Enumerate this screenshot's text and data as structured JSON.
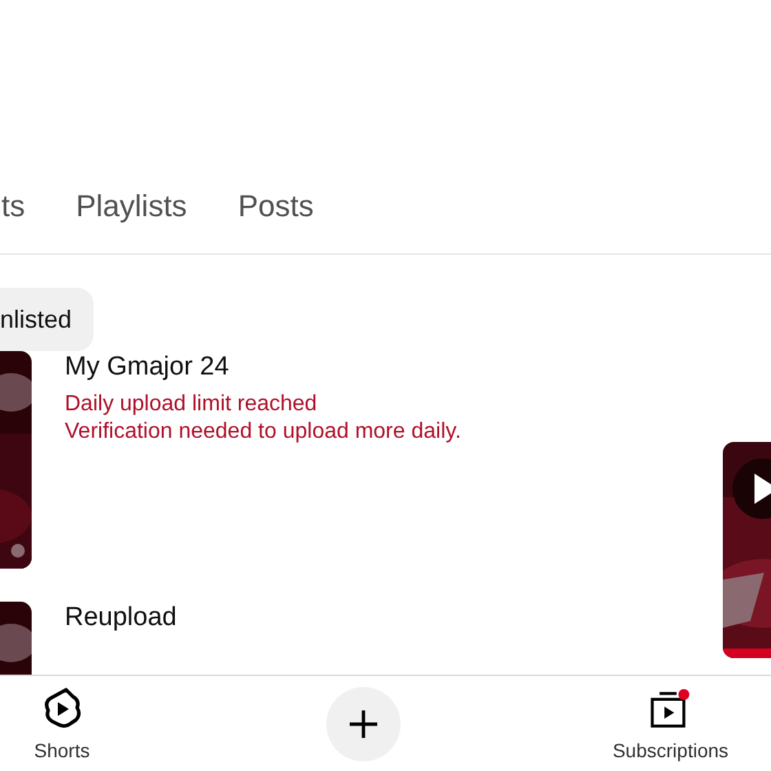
{
  "tabs": [
    {
      "label": "ts"
    },
    {
      "label": "Playlists"
    },
    {
      "label": "Posts"
    }
  ],
  "filter_chips": [
    {
      "label": "nlisted"
    }
  ],
  "videos": [
    {
      "title": "My Gmajor 24",
      "notices": [
        "Daily upload limit reached",
        "Verification needed to upload more daily."
      ]
    },
    {
      "title": "Reupload"
    }
  ],
  "bottom_nav": [
    {
      "kind": "shorts",
      "label": "Shorts"
    },
    {
      "kind": "create"
    },
    {
      "kind": "subscriptions",
      "label": "Subscriptions"
    }
  ]
}
